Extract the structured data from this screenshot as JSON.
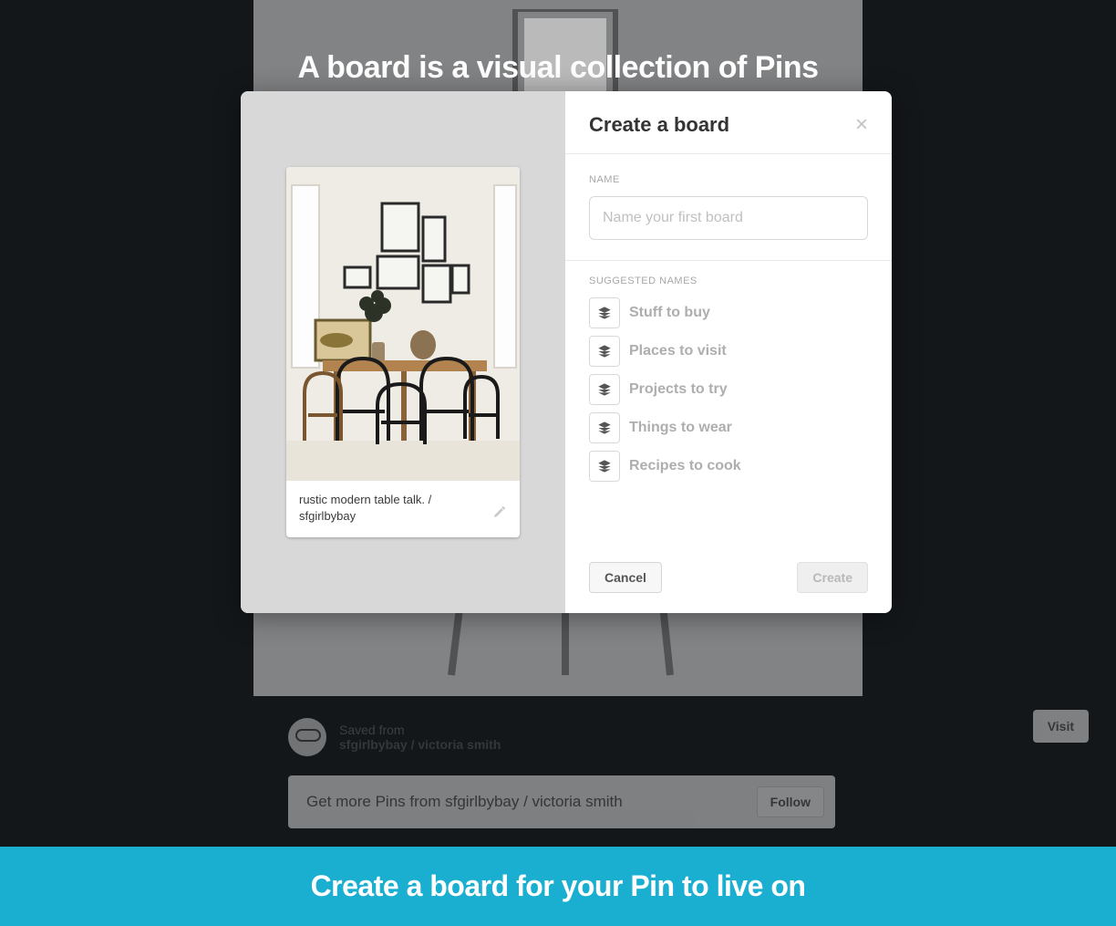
{
  "overlay": {
    "title": "A board is a visual collection of Pins",
    "footer": "Create a board for your Pin to live on"
  },
  "modal": {
    "title": "Create a board",
    "name_label": "NAME",
    "name_placeholder": "Name your first board",
    "suggested_label": "SUGGESTED NAMES",
    "suggestions": {
      "0": "Stuff to buy",
      "1": "Places to visit",
      "2": "Projects to try",
      "3": "Things to wear",
      "4": "Recipes to cook"
    },
    "cancel": "Cancel",
    "create": "Create"
  },
  "pin": {
    "caption": "rustic modern table talk. / sfgirlbybay"
  },
  "background": {
    "saved_from_label": "Saved from",
    "source": "sfgirlbybay / victoria smith",
    "visit": "Visit",
    "get_more": "Get more Pins from sfgirlbybay / victoria smith",
    "follow": "Follow"
  }
}
